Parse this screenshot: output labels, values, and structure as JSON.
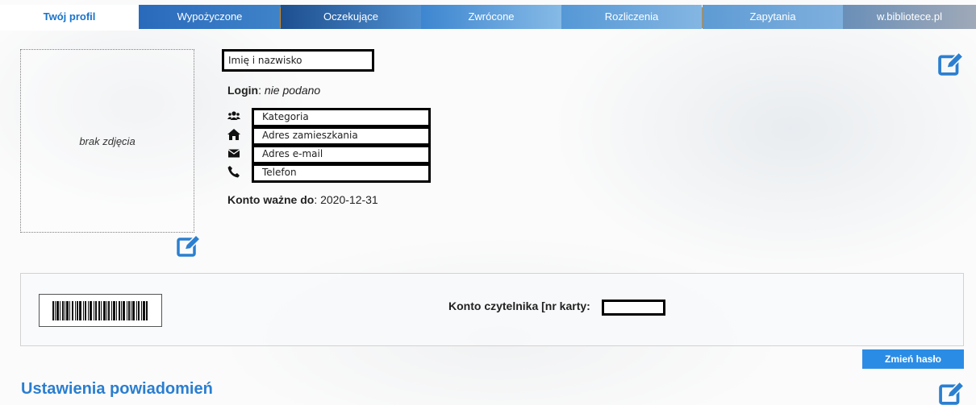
{
  "tabs": [
    {
      "label": "Twój profil",
      "active": true
    },
    {
      "label": "Wypożyczone"
    },
    {
      "label": "Oczekujące"
    },
    {
      "label": "Zwrócone"
    },
    {
      "label": "Rozliczenia"
    },
    {
      "label": "Zapytania"
    },
    {
      "label": "w.bibliotece.pl"
    }
  ],
  "photo": {
    "placeholder": "brak zdjęcia"
  },
  "profile": {
    "name_field": "Imię i nazwisko",
    "login_label": "Login",
    "login_value": "nie podano",
    "category_field": "Kategoria",
    "address_field": "Adres zamieszkania",
    "email_field": "Adres e-mail",
    "phone_field": "Telefon",
    "valid_label": "Konto ważne do",
    "valid_value": "2020-12-31"
  },
  "icons": {
    "category": "users-icon",
    "address": "home-icon",
    "email": "envelope-icon",
    "phone": "phone-icon",
    "edit": "edit-icon"
  },
  "account": {
    "label": "Konto czytelnika [nr karty:",
    "card_number": ""
  },
  "buttons": {
    "change_password": "Zmień hasło"
  },
  "sections": {
    "notifications_title": "Ustawienia powiadomień"
  },
  "colors": {
    "accent": "#2a7ed0",
    "button": "#2b8ce6",
    "active_tab_text": "#1a73c9"
  }
}
